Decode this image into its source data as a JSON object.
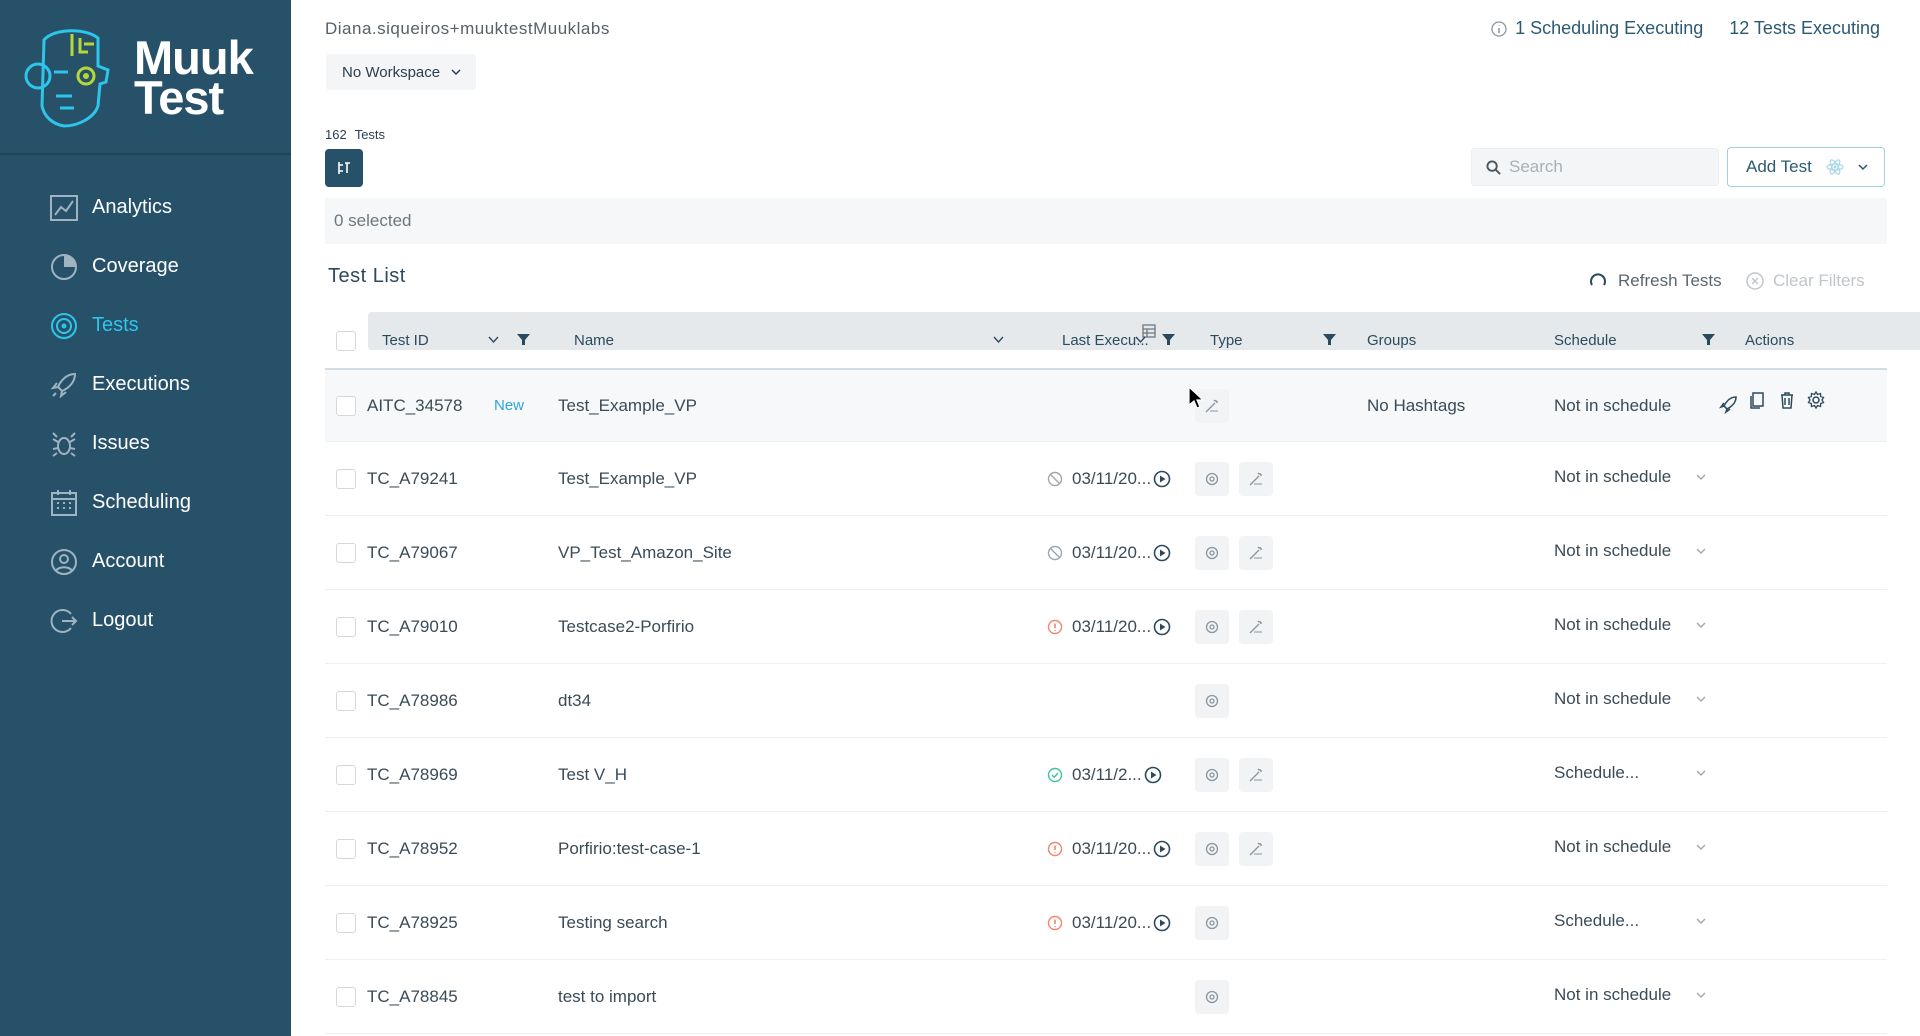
{
  "brand": {
    "line1": "Muuk",
    "line2": "Test"
  },
  "sidebar": {
    "items": [
      {
        "label": "Analytics",
        "icon": "analytics-icon",
        "active": false
      },
      {
        "label": "Coverage",
        "icon": "coverage-icon",
        "active": false
      },
      {
        "label": "Tests",
        "icon": "tests-icon",
        "active": true
      },
      {
        "label": "Executions",
        "icon": "rocket-icon",
        "active": false
      },
      {
        "label": "Issues",
        "icon": "bug-icon",
        "active": false
      },
      {
        "label": "Scheduling",
        "icon": "calendar-icon",
        "active": false
      },
      {
        "label": "Account",
        "icon": "account-icon",
        "active": false
      },
      {
        "label": "Logout",
        "icon": "logout-icon",
        "active": false
      }
    ]
  },
  "header": {
    "user": "Diana.siqueiros+muuktestMuuklabs",
    "scheduling_executing": "1 Scheduling Executing",
    "tests_executing": "12 Tests Executing",
    "workspace": "No Workspace"
  },
  "toolbar": {
    "count": "162",
    "count_label": "Tests",
    "search_placeholder": "Search",
    "add_test_label": "Add Test",
    "selected_text": "0 selected"
  },
  "list": {
    "title": "Test List",
    "refresh_label": "Refresh Tests",
    "clear_label": "Clear Filters",
    "columns": {
      "test_id": "Test ID",
      "name": "Name",
      "last_execution": "Last Execu...",
      "type": "Type",
      "groups": "Groups",
      "schedule": "Schedule",
      "actions": "Actions"
    },
    "rows": [
      {
        "id": "AITC_34578",
        "badge": "New",
        "name": "Test_Example_VP",
        "status": "",
        "date": "",
        "groups": "No Hashtags",
        "schedule": "Not in schedule"
      },
      {
        "id": "TC_A79241",
        "badge": "",
        "name": "Test_Example_VP",
        "status": "cancelled",
        "date": "03/11/20...",
        "groups": "",
        "schedule": "Not in schedule"
      },
      {
        "id": "TC_A79067",
        "badge": "",
        "name": "VP_Test_Amazon_Site",
        "status": "cancelled",
        "date": "03/11/20...",
        "groups": "",
        "schedule": "Not in schedule"
      },
      {
        "id": "TC_A79010",
        "badge": "",
        "name": "Testcase2-Porfirio",
        "status": "failed",
        "date": "03/11/20...",
        "groups": "",
        "schedule": "Not in schedule"
      },
      {
        "id": "TC_A78986",
        "badge": "",
        "name": "dt34",
        "status": "",
        "date": "",
        "groups": "",
        "schedule": "Not in schedule"
      },
      {
        "id": "TC_A78969",
        "badge": "",
        "name": "Test V_H",
        "status": "passed",
        "date": "03/11/2...",
        "groups": "",
        "schedule": "Schedule..."
      },
      {
        "id": "TC_A78952",
        "badge": "",
        "name": "Porfirio:test-case-1",
        "status": "failed",
        "date": "03/11/20...",
        "groups": "",
        "schedule": "Not in schedule"
      },
      {
        "id": "TC_A78925",
        "badge": "",
        "name": "Testing search",
        "status": "failed",
        "date": "03/11/20...",
        "groups": "",
        "schedule": "Schedule..."
      },
      {
        "id": "TC_A78845",
        "badge": "",
        "name": "test to import",
        "status": "",
        "date": "",
        "groups": "",
        "schedule": "Not in schedule"
      }
    ]
  },
  "colors": {
    "sidebar": "#275169",
    "accent": "#2ec5ea",
    "failed": "#f0876b",
    "passed": "#46c2a0",
    "cancelled": "#a0a8ae"
  }
}
